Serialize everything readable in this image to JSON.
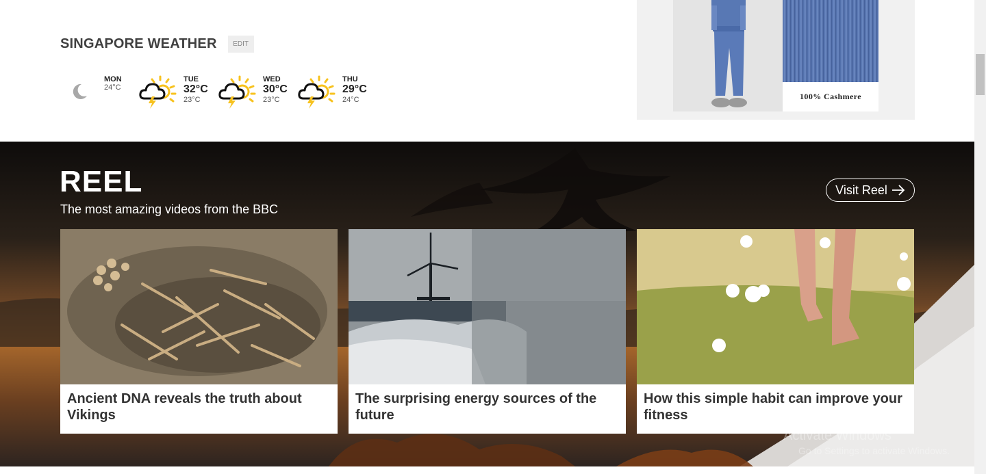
{
  "weather": {
    "title": "SINGAPORE WEATHER",
    "edit_label": "EDIT",
    "days": [
      {
        "name": "MON",
        "low": "24°C",
        "icon": "moon-icon"
      },
      {
        "name": "TUE",
        "high": "32°C",
        "low": "23°C",
        "icon": "thunderstorm-icon"
      },
      {
        "name": "WED",
        "high": "30°C",
        "low": "23°C",
        "icon": "thunderstorm-icon"
      },
      {
        "name": "THU",
        "high": "29°C",
        "low": "24°C",
        "icon": "thunderstorm-icon"
      }
    ]
  },
  "ad": {
    "caption": "100% Cashmere"
  },
  "reel": {
    "title": "REEL",
    "subtitle": "The most amazing videos from the BBC",
    "visit_label": "Visit Reel",
    "cards": [
      {
        "title": "Ancient DNA reveals the truth about Vikings"
      },
      {
        "title": "The surprising energy sources of the future"
      },
      {
        "title": "How this simple habit can improve your fitness"
      }
    ]
  },
  "watermark": {
    "line1": "Activate Windows",
    "line2": "Go to Settings to activate Windows."
  },
  "colors": {
    "weather_title": "#404040",
    "sun_yellow": "#f7c21e",
    "reel_dark": "#1b1612",
    "reel_orange": "#8a5a2a",
    "card_title": "#333333"
  }
}
